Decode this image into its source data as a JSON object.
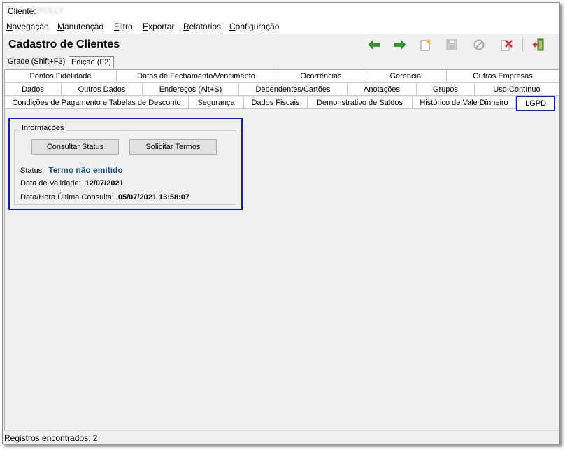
{
  "window": {
    "client_label": "Cliente:",
    "client_name": "POLLY"
  },
  "menu": [
    {
      "label": "Navegação",
      "accel": "N",
      "rest": "avegação"
    },
    {
      "label": "Manutenção",
      "accel": "M",
      "rest": "anutenção"
    },
    {
      "label": "Filtro",
      "accel": "F",
      "rest": "iltro"
    },
    {
      "label": "Exportar",
      "accel": "E",
      "rest": "xportar"
    },
    {
      "label": "Relatórios",
      "accel": "R",
      "rest": "elatórios"
    },
    {
      "label": "Configuração",
      "accel": "C",
      "rest": "onfiguração"
    }
  ],
  "header": {
    "title": "Cadastro de Clientes"
  },
  "toolbar": {
    "icons": [
      "arrow-left-icon",
      "arrow-right-icon",
      "new-record-icon",
      "save-icon",
      "cancel-icon",
      "delete-icon",
      "exit-icon"
    ],
    "colors": {
      "green": "#2e9e2e",
      "red": "#d42a2a",
      "gray": "#a8a8a8"
    }
  },
  "view_tabs": [
    "Grade (Shift+F3)",
    "Edição (F2)"
  ],
  "tabs": {
    "row1": [
      "Pontos Fidelidade",
      "Datas de Fechamento/Vencimento",
      "Ocorrências",
      "Gerencial",
      "Outras Empresas"
    ],
    "row2": [
      "Dados",
      "Outros Dados",
      "Endereços (Alt+S)",
      "Dependentes/Cartões",
      "Anotações",
      "Grupos",
      "Uso Contínuo"
    ],
    "row3": [
      "Condições de Pagamento e Tabelas de Desconto",
      "Segurança",
      "Dados Fiscais",
      "Demonstrativo de Saldos",
      "Histórico de Vale Dinheiro",
      "LGPD"
    ]
  },
  "lgpd": {
    "group_title": "Informações",
    "consult_button": "Consultar Status",
    "request_button": "Solicitar Termos",
    "status_label": "Status:",
    "status_value": "Termo não emitido",
    "validity_label": "Data de Validade:",
    "validity_value": "12/07/2021",
    "last_query_label": "Data/Hora Última Consulta:",
    "last_query_value": "05/07/2021 13:58:07",
    "highlight_color": "#0b1fd1"
  },
  "statusbar": {
    "text": "Registros encontrados: 2"
  }
}
